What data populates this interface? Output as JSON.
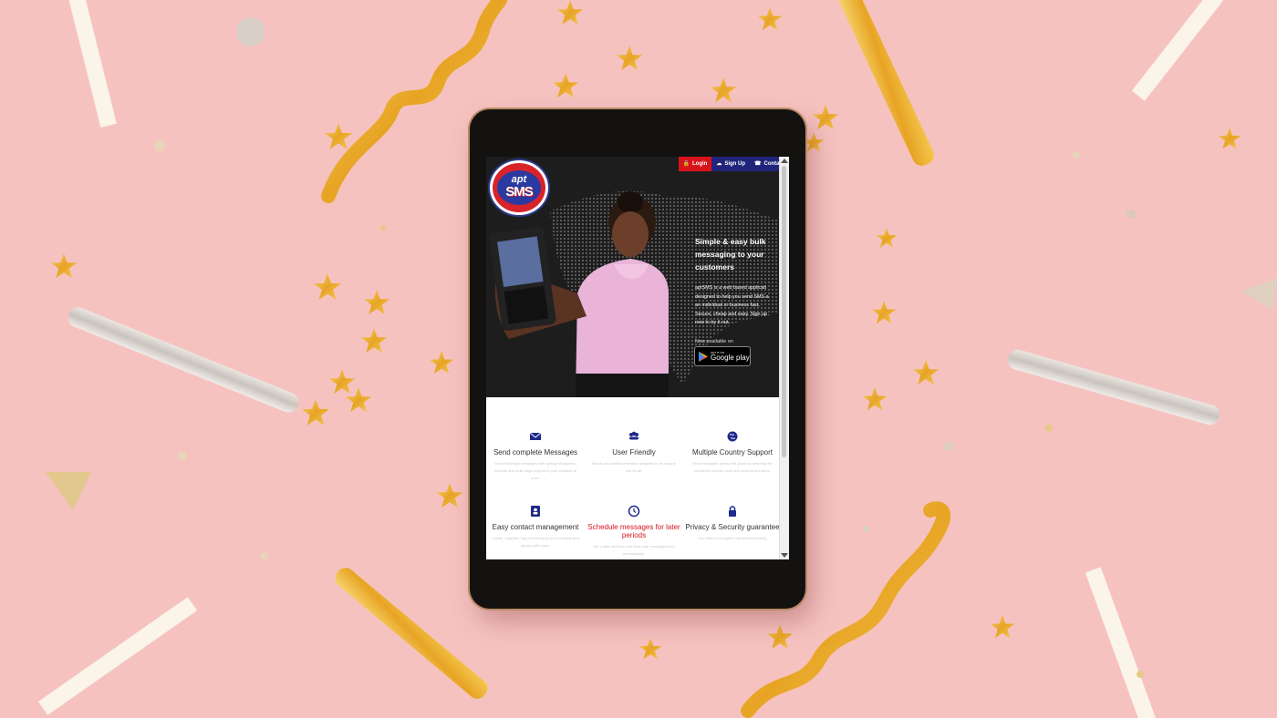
{
  "website": {
    "nav": {
      "login": "Login",
      "signup": "Sign Up",
      "contact": "Contact"
    },
    "logo": {
      "line1": "apt",
      "line2": "SMS"
    },
    "hero": {
      "tagline_lines": [
        "Simple & easy bulk",
        "messaging to your",
        "customers"
      ],
      "description_lines": [
        "aptSMS is a web based applicati",
        "designed to help you send SMS a",
        "an individual or business fast,",
        "Secure, cheap and easy. Sign up",
        "now to try it out."
      ],
      "available_on": "Now available on",
      "store_small": "GET IT ON",
      "store_name": "Google play"
    },
    "features": [
      {
        "icon": "envelope-icon",
        "title": "Send complete Messages",
        "desc": "Send full-length messages with special characters, unicode and multi-page support to your contacts at once."
      },
      {
        "icon": "users-icon",
        "title": "User Friendly",
        "desc": "Simple and intuitive interface designed to be easy to use for all."
      },
      {
        "icon": "globe-icon",
        "title": "Multiple Country Support",
        "desc": "Send messages across the globe by selecting the recipient's country code and network operators."
      },
      {
        "icon": "contact-book-icon",
        "title": "Easy contact management",
        "desc": "Create, organise, import and export your contacts and groups with ease."
      },
      {
        "icon": "clock-icon",
        "title": "Schedule messages for later periods",
        "desc": "Set a date and time and have your messages sent automatically."
      },
      {
        "icon": "lock-icon",
        "title": "Privacy & Security guarantee",
        "desc": "Your data is encrypted and stored securely."
      }
    ]
  },
  "colors": {
    "background": "#f6c2c0",
    "brand_red": "#d7141b",
    "brand_blue": "#20247a",
    "gold": "#f0b323"
  }
}
